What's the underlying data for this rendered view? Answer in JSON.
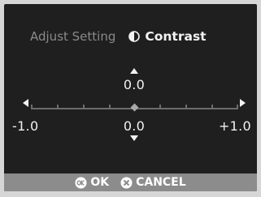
{
  "header": {
    "setting_label": "Adjust Setting",
    "current_setting": "Contrast"
  },
  "slider": {
    "value_top": "0.0",
    "min_label": "-1.0",
    "mid_label": "0.0",
    "max_label": "+1.0",
    "position": 0.5
  },
  "footer": {
    "ok_label": "OK",
    "cancel_label": "CANCEL"
  },
  "icons": {
    "contrast": "contrast-icon",
    "ok": "ok-button-icon",
    "cancel": "cancel-x-icon",
    "up": "triangle-up-icon",
    "down": "triangle-down-icon",
    "left": "triangle-left-icon",
    "right": "triangle-right-icon"
  },
  "colors": {
    "screen": "#1f1f1f",
    "text": "#f2f2f2",
    "dim_text": "#8a8a8a",
    "footer": "#8c8c8c"
  }
}
